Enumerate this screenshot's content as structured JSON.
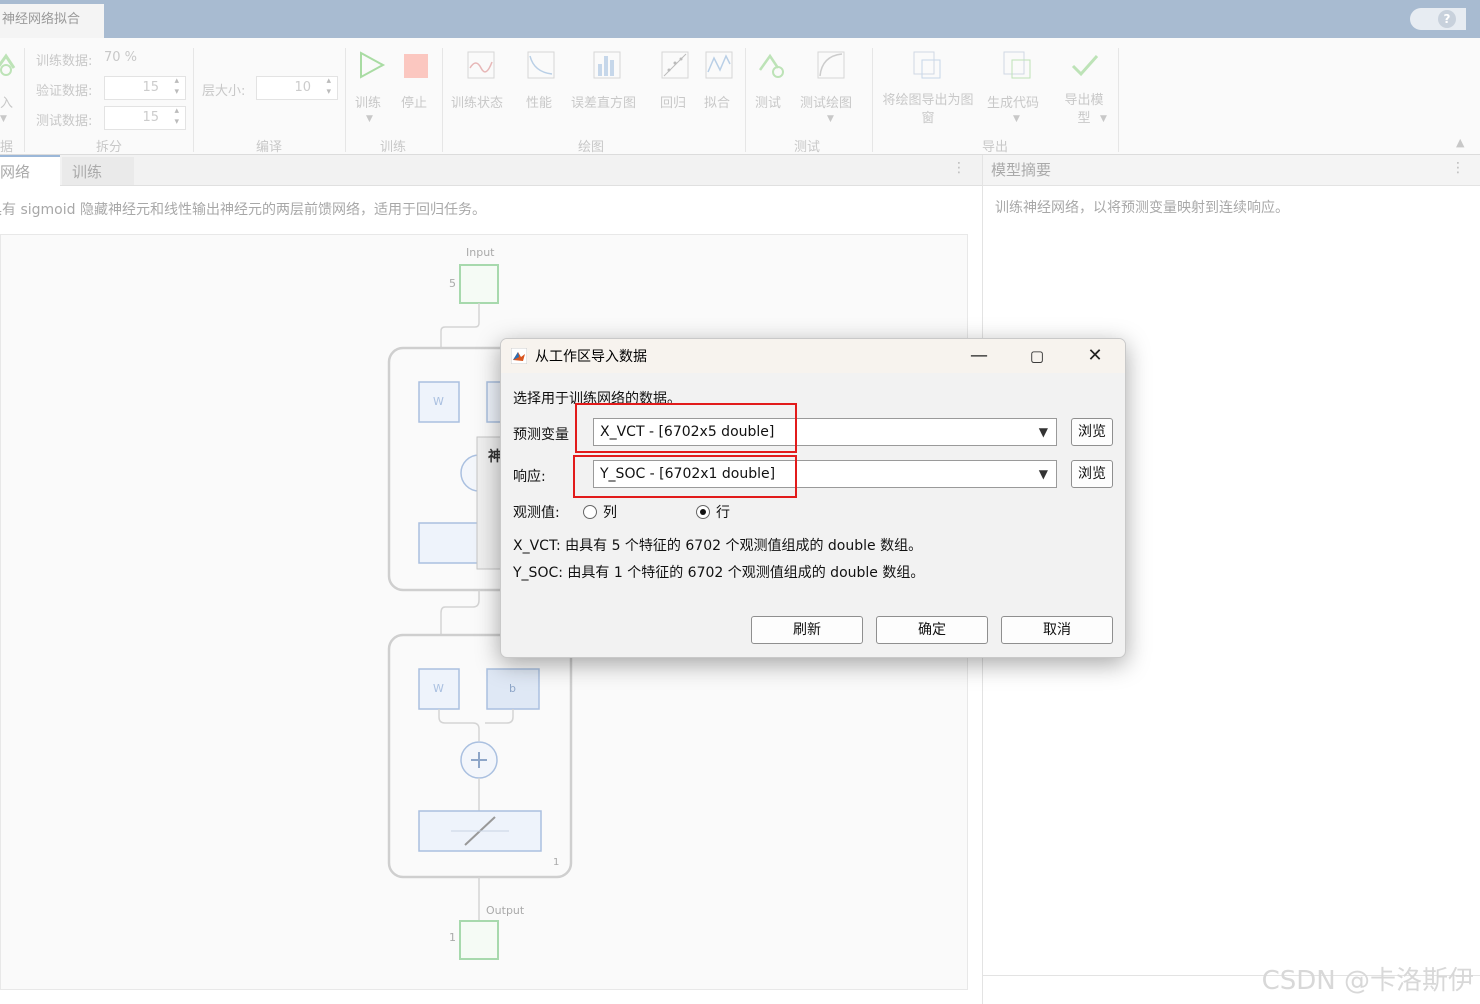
{
  "app": {
    "window_tab": "神经网络拟合",
    "help_icon": "?"
  },
  "toolstrip": {
    "data_group": {
      "import_label": "入",
      "group_label": "据"
    },
    "split_group": {
      "train_label": "训练数据:",
      "train_value": "70 %",
      "val_label": "验证数据:",
      "val_value": "15",
      "test_label": "测试数据:",
      "test_value": "15",
      "group_label": "拆分"
    },
    "compile_group": {
      "layer_size_label": "层大小:",
      "layer_size_value": "10",
      "group_label": "编译"
    },
    "train_group": {
      "train_label": "训练",
      "stop_label": "停止",
      "group_label": "训练"
    },
    "plot_group": {
      "items": [
        "训练状态",
        "性能",
        "误差直方图",
        "回归",
        "拟合"
      ],
      "group_label": "绘图"
    },
    "test_group": {
      "items": [
        "测试",
        "测试绘图"
      ],
      "group_label": "测试"
    },
    "export_group": {
      "export_plot_label": "将绘图导出为图窗",
      "generate_code_label": "生成代码",
      "export_model_label": "导出模型",
      "group_label": "导出"
    }
  },
  "left_panel": {
    "tabs": [
      "网络",
      "训练"
    ],
    "description": "具有 sigmoid 隐藏神经元和线性输出神经元的两层前馈网络，适用于回归任务。",
    "diagram": {
      "input_label": "Input",
      "input_size": "5",
      "weight_label": "W",
      "bias_label": "b",
      "layer2_index": "1",
      "output_label": "Output",
      "output_size": "1",
      "hidden_dialog_fragment": "神"
    }
  },
  "right_panel": {
    "title": "模型摘要",
    "description": "训练神经网络，以将预测变量映射到连续响应。"
  },
  "dialog": {
    "title": "从工作区导入数据",
    "instruction": "选择用于训练网络的数据。",
    "predictor_label": "预测变量",
    "predictor_value": "X_VCT - [6702x5 double]",
    "response_label": "响应:",
    "response_value": "Y_SOC - [6702x1 double]",
    "browse_label": "浏览",
    "observations_label": "观测值:",
    "observations_options": [
      "列",
      "行"
    ],
    "observations_selected": "行",
    "info_line1": "X_VCT: 由具有 5 个特征的 6702 个观测值组成的 double 数组。",
    "info_line2": "Y_SOC: 由具有 1 个特征的 6702 个观测值组成的 double 数组。",
    "refresh_label": "刷新",
    "ok_label": "确定",
    "cancel_label": "取消"
  },
  "watermark": "CSDN @卡洛斯伊",
  "colors": {
    "topbar": "#a8bbd1",
    "annotation_red": "#e21b1b",
    "diagram_blue": "#9fb6d9",
    "diagram_green": "#9fd4a6"
  }
}
